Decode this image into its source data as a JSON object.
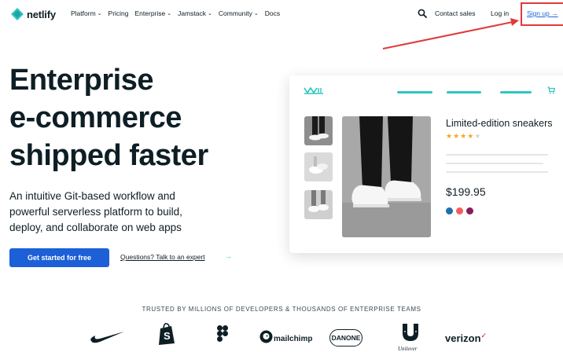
{
  "nav": {
    "brand": "netlify",
    "menu": [
      {
        "label": "Platform",
        "has_dropdown": true
      },
      {
        "label": "Pricing",
        "has_dropdown": false
      },
      {
        "label": "Enterprise",
        "has_dropdown": true
      },
      {
        "label": "Jamstack",
        "has_dropdown": true
      },
      {
        "label": "Community",
        "has_dropdown": true
      },
      {
        "label": "Docs",
        "has_dropdown": false
      }
    ],
    "search_icon": "search-icon",
    "contact": "Contact sales",
    "login": "Log in",
    "signup": "Sign up",
    "signup_arrow": "→",
    "annotation_color": "#e03a3a"
  },
  "hero": {
    "title_lines": [
      "Enterprise",
      "e-commerce",
      "shipped faster"
    ],
    "subtitle_lines": [
      "An intuitive Git-based workflow and",
      "powerful serverless platform to build,",
      "deploy, and collaborate on web apps"
    ],
    "cta": "Get started for free",
    "talk_link": "Questions? Talk to an expert",
    "talk_arrow": "→"
  },
  "product_card": {
    "name": "Limited-edition sneakers",
    "rating": 4,
    "max_rating": 5,
    "price": "$199.95",
    "color_swatches": [
      "#1f6fa8",
      "#f25f5c",
      "#8a1a5c"
    ],
    "accent": "#2fc5bf"
  },
  "trusted": {
    "headline": "TRUSTED BY MILLIONS OF DEVELOPERS & THOUSANDS OF ENTERPRISE TEAMS",
    "logos": [
      "nike-logo",
      "shopify-logo",
      "figma-logo",
      "mailchimp-logo",
      "danone-logo",
      "unilever-logo",
      "verizon-logo"
    ],
    "mailchimp": "mailchimp",
    "danone": "DANONE",
    "unilever": "Unilever",
    "verizon": "verizon",
    "verizon_mark": "✓"
  },
  "colors": {
    "primary_button": "#1d5fd6",
    "link": "#1e66d8",
    "teal": "#2fc5bf",
    "text": "#0e1e25"
  }
}
